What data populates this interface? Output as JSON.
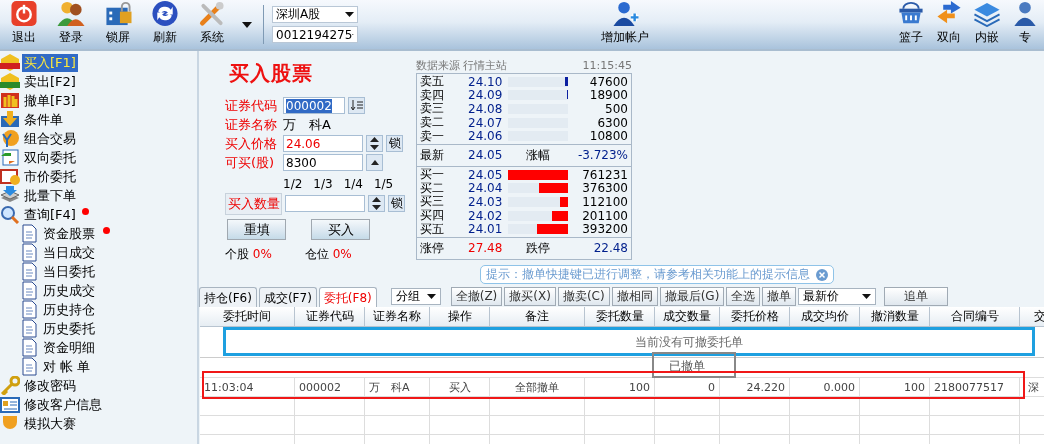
{
  "toolbar": {
    "left_buttons": [
      {
        "label": "退出"
      },
      {
        "label": "登录"
      },
      {
        "label": "锁屏"
      },
      {
        "label": "刷新"
      },
      {
        "label": "系统"
      }
    ],
    "market_select": "深圳A股",
    "account_select": "0012194275",
    "center_button": "增加帐户",
    "right_buttons": [
      {
        "label": "篮子"
      },
      {
        "label": "双向"
      },
      {
        "label": "内嵌"
      },
      {
        "label": "专"
      }
    ]
  },
  "sidebar": {
    "items": [
      {
        "label": "买入[F1]",
        "selected": true,
        "dot": false
      },
      {
        "label": "卖出[F2]",
        "selected": false,
        "dot": false
      },
      {
        "label": "撤单[F3]",
        "selected": false,
        "dot": false
      },
      {
        "label": "条件单",
        "selected": false,
        "dot": false
      },
      {
        "label": "组合交易",
        "selected": false,
        "dot": false
      },
      {
        "label": "双向委托",
        "selected": false,
        "dot": false
      },
      {
        "label": "市价委托",
        "selected": false,
        "dot": false
      },
      {
        "label": "批量下单",
        "selected": false,
        "dot": false
      },
      {
        "label": "查询[F4]",
        "selected": false,
        "dot": true,
        "children": [
          {
            "label": "资金股票",
            "selected": false,
            "dot": true
          },
          {
            "label": "当日成交",
            "selected": false,
            "dot": false
          },
          {
            "label": "当日委托",
            "selected": false,
            "dot": false
          },
          {
            "label": "历史成交",
            "selected": false,
            "dot": false
          },
          {
            "label": "历史持仓",
            "selected": false,
            "dot": false
          },
          {
            "label": "历史委托",
            "selected": false,
            "dot": false
          },
          {
            "label": "资金明细",
            "selected": false,
            "dot": false
          },
          {
            "label": "对 帐 单",
            "selected": false,
            "dot": false
          }
        ]
      },
      {
        "label": "修改密码",
        "selected": false,
        "dot": false
      },
      {
        "label": "修改客户信息",
        "selected": false,
        "dot": false
      },
      {
        "label": "模拟大赛",
        "selected": false,
        "dot": false
      }
    ]
  },
  "order_form": {
    "title": "买入股票",
    "fields": [
      {
        "kind": "code",
        "label": "证券代码",
        "value": "000002"
      },
      {
        "kind": "name",
        "label": "证券名称",
        "value": "万　科A"
      },
      {
        "kind": "price",
        "label": "买入价格",
        "value": "24.06",
        "lock": "锁"
      },
      {
        "kind": "max",
        "label": "可买(股)",
        "value": "8300"
      }
    ],
    "fractions": [
      "1/2",
      "1/3",
      "1/4",
      "1/5"
    ],
    "quantity": {
      "label": "买入数量",
      "lock": "锁"
    },
    "buttons": [
      "重填",
      "买入"
    ],
    "stats": [
      {
        "label": "个股",
        "value": "0%"
      },
      {
        "label": "仓位",
        "value": "0%"
      }
    ]
  },
  "quote": {
    "source_label": "数据来源",
    "source": "行情主站",
    "time": "11:15:45",
    "sells": [
      {
        "label": "卖五",
        "price": "24.10",
        "volume": "47600",
        "level": 0.05
      },
      {
        "label": "卖四",
        "price": "24.09",
        "volume": "18900",
        "level": 0.02
      },
      {
        "label": "卖三",
        "price": "24.08",
        "volume": "500",
        "level": 0
      },
      {
        "label": "卖二",
        "price": "24.07",
        "volume": "6300",
        "level": 0
      },
      {
        "label": "卖一",
        "price": "24.06",
        "volume": "10800",
        "level": 0
      }
    ],
    "latest": {
      "label": "最新",
      "price": "24.05",
      "change_label": "涨幅",
      "change": "-3.723%"
    },
    "buys": [
      {
        "label": "买一",
        "price": "24.05",
        "volume": "761231",
        "level": 1
      },
      {
        "label": "买二",
        "price": "24.04",
        "volume": "376300",
        "level": 0.49
      },
      {
        "label": "买三",
        "price": "24.03",
        "volume": "112100",
        "level": 0.14
      },
      {
        "label": "买四",
        "price": "24.02",
        "volume": "201100",
        "level": 0.26
      },
      {
        "label": "买五",
        "price": "24.01",
        "volume": "393200",
        "level": 0.51
      }
    ],
    "limits": {
      "up_label": "涨停",
      "up": "27.48",
      "down_label": "跌停",
      "down": "22.48"
    }
  },
  "tip": "提示：撤单快捷键已进行调整，请参考相关功能上的提示信息",
  "tabs": [
    {
      "label": "持仓(F6)",
      "selected": false
    },
    {
      "label": "成交(F7)",
      "selected": false
    },
    {
      "label": "委托(F8)",
      "selected": true
    }
  ],
  "order_toolbar": {
    "group_select": "分组",
    "buttons": [
      "全撤(Z)",
      "撤买(X)",
      "撤卖(C)",
      "撤相同",
      "撤最后(G)",
      "全选",
      "撤单"
    ],
    "price_select": "最新价",
    "follow_button": "追单"
  },
  "orders": {
    "columns": [
      "委托时间",
      "证券代码",
      "证券名称",
      "操作",
      "备注",
      "委托数量",
      "成交数量",
      "委托价格",
      "成交均价",
      "撤消数量",
      "合同编号",
      "交"
    ],
    "empty_message": "当前没有可撤委托单",
    "group_label": "已撤单",
    "rows": [
      [
        "11:03:04",
        "000002",
        "万　科A",
        "买入",
        "全部撤单",
        "100",
        "0",
        "24.220",
        "0.000",
        "100",
        "2180077517",
        "深"
      ]
    ]
  }
}
